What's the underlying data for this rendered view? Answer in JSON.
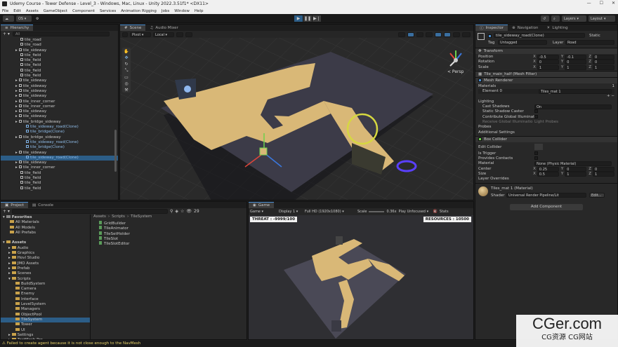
{
  "window": {
    "title": "Udemy Course - Tower Defense - Level_3 - Windows, Mac, Linux - Unity 2022.3.51f1* <DX11>",
    "min": "—",
    "max": "☐",
    "close": "✕"
  },
  "menu": [
    "File",
    "Edit",
    "Assets",
    "GameObject",
    "Component",
    "Services",
    "Animation Rigging",
    "Jobs",
    "Window",
    "Help"
  ],
  "toolbar": {
    "account": "OS ▾",
    "layers": "Layers",
    "layout": "Layout"
  },
  "hierarchy": {
    "tab": "Hierarchy",
    "search_placeholder": "All",
    "rows": [
      {
        "label": "tile_road",
        "indent": 0,
        "arrow": false,
        "prefab": false
      },
      {
        "label": "tile_road",
        "indent": 0,
        "arrow": false,
        "prefab": false
      },
      {
        "label": "tile_sideway",
        "indent": 0,
        "arrow": true,
        "prefab": false
      },
      {
        "label": "tile_field",
        "indent": 0,
        "arrow": false,
        "prefab": false
      },
      {
        "label": "tile_field",
        "indent": 0,
        "arrow": false,
        "prefab": false
      },
      {
        "label": "tile_field",
        "indent": 0,
        "arrow": false,
        "prefab": false
      },
      {
        "label": "tile_field",
        "indent": 0,
        "arrow": false,
        "prefab": false
      },
      {
        "label": "tile_field",
        "indent": 0,
        "arrow": false,
        "prefab": false
      },
      {
        "label": "tile_sideway",
        "indent": 0,
        "arrow": true,
        "prefab": false
      },
      {
        "label": "tile_sideway",
        "indent": 0,
        "arrow": true,
        "prefab": false
      },
      {
        "label": "tile_sideway",
        "indent": 0,
        "arrow": true,
        "prefab": false
      },
      {
        "label": "tile_sideway",
        "indent": 0,
        "arrow": true,
        "prefab": false
      },
      {
        "label": "tile_inner_corner",
        "indent": 0,
        "arrow": true,
        "prefab": false
      },
      {
        "label": "tile_inner_corner",
        "indent": 0,
        "arrow": true,
        "prefab": false
      },
      {
        "label": "tile_sideway",
        "indent": 0,
        "arrow": true,
        "prefab": false
      },
      {
        "label": "tile_sideway",
        "indent": 0,
        "arrow": true,
        "prefab": false
      },
      {
        "label": "tile_bridge_sideway",
        "indent": 0,
        "arrow": true,
        "prefab": false
      },
      {
        "label": "tile_sideway_road(Clone)",
        "indent": 1,
        "arrow": false,
        "prefab": true
      },
      {
        "label": "tile_bridge(Clone)",
        "indent": 1,
        "arrow": false,
        "prefab": true
      },
      {
        "label": "tile_bridge_sideway",
        "indent": 0,
        "arrow": true,
        "prefab": false
      },
      {
        "label": "tile_sideway_road(Clone)",
        "indent": 1,
        "arrow": false,
        "prefab": true
      },
      {
        "label": "tile_bridge(Clone)",
        "indent": 1,
        "arrow": false,
        "prefab": true
      },
      {
        "label": "tile_sideway",
        "indent": 0,
        "arrow": true,
        "prefab": false
      },
      {
        "label": "tile_sideway_road(Clone)",
        "indent": 1,
        "arrow": false,
        "prefab": true,
        "selected": true
      },
      {
        "label": "tile_sideway",
        "indent": 0,
        "arrow": true,
        "prefab": false
      },
      {
        "label": "tile_inner_corner",
        "indent": 0,
        "arrow": true,
        "prefab": false
      },
      {
        "label": "tile_field",
        "indent": 0,
        "arrow": false,
        "prefab": false
      },
      {
        "label": "tile_field",
        "indent": 0,
        "arrow": false,
        "prefab": false
      },
      {
        "label": "tile_field",
        "indent": 0,
        "arrow": false,
        "prefab": false
      },
      {
        "label": "tile_field",
        "indent": 0,
        "arrow": false,
        "prefab": false
      }
    ]
  },
  "scene": {
    "tabs": [
      "Scene",
      "Audio Mixer"
    ],
    "pivot": "Pivot",
    "local": "Local",
    "persp": "< Persp"
  },
  "project": {
    "tabs": [
      "Project",
      "Console"
    ],
    "count": "29",
    "breadcrumb": [
      "Assets",
      "Scripts",
      "TileSystem"
    ],
    "tree": [
      {
        "label": "Favorites",
        "indent": 0,
        "bold": true,
        "arrow": "▾"
      },
      {
        "label": "All Materials",
        "indent": 1,
        "bold": false,
        "arrow": ""
      },
      {
        "label": "All Models",
        "indent": 1,
        "bold": false,
        "arrow": ""
      },
      {
        "label": "All Prefabs",
        "indent": 1,
        "bold": false,
        "arrow": ""
      },
      {
        "label": "",
        "indent": 0,
        "bold": false,
        "arrow": ""
      },
      {
        "label": "Assets",
        "indent": 0,
        "bold": true,
        "arrow": "▾"
      },
      {
        "label": "Audio",
        "indent": 1,
        "bold": false,
        "arrow": "▸"
      },
      {
        "label": "Graphics",
        "indent": 1,
        "bold": false,
        "arrow": "▸"
      },
      {
        "label": "Hovl Studio",
        "indent": 1,
        "bold": false,
        "arrow": "▸"
      },
      {
        "label": "JMO Assets",
        "indent": 1,
        "bold": false,
        "arrow": "▸"
      },
      {
        "label": "Prefab",
        "indent": 1,
        "bold": false,
        "arrow": "▸"
      },
      {
        "label": "Scenes",
        "indent": 1,
        "bold": false,
        "arrow": "▸"
      },
      {
        "label": "Scripts",
        "indent": 1,
        "bold": false,
        "arrow": "▾"
      },
      {
        "label": "BuildSystem",
        "indent": 2,
        "bold": false,
        "arrow": ""
      },
      {
        "label": "Camera",
        "indent": 2,
        "bold": false,
        "arrow": ""
      },
      {
        "label": "Enemy",
        "indent": 2,
        "bold": false,
        "arrow": ""
      },
      {
        "label": "Interface",
        "indent": 2,
        "bold": false,
        "arrow": ""
      },
      {
        "label": "LevelSystem",
        "indent": 2,
        "bold": false,
        "arrow": ""
      },
      {
        "label": "Managers",
        "indent": 2,
        "bold": false,
        "arrow": ""
      },
      {
        "label": "ObjectPool",
        "indent": 2,
        "bold": false,
        "arrow": ""
      },
      {
        "label": "TileSystem",
        "indent": 2,
        "bold": false,
        "arrow": "",
        "selected": true
      },
      {
        "label": "Tower",
        "indent": 2,
        "bold": false,
        "arrow": ""
      },
      {
        "label": "UI",
        "indent": 2,
        "bold": false,
        "arrow": ""
      },
      {
        "label": "Settings",
        "indent": 1,
        "bold": false,
        "arrow": "▸"
      },
      {
        "label": "TextMesh Pro",
        "indent": 1,
        "bold": false,
        "arrow": "▸"
      }
    ],
    "files": [
      "GridBuilder",
      "TileAnimator",
      "TileSetHolder",
      "TileSlot",
      "TileSlotEditor"
    ]
  },
  "game": {
    "tab": "Game",
    "mode": "Game",
    "display": "Display 1",
    "resolution": "Full HD (1920x1080)",
    "scale_label": "Scale",
    "scale_value": "0.36x",
    "play_focus": "Play Unfocused",
    "stats": "Stats",
    "threat": "THREAT : -9999/100",
    "resources": "RESOURCES : 10500"
  },
  "inspector": {
    "tabs": [
      "Inspector",
      "Navigation",
      "Lighting"
    ],
    "object_name": "tile_sideway_road(Clone)",
    "static": "Static",
    "tag_label": "Tag",
    "tag": "Untagged",
    "layer_label": "Layer",
    "layer": "Road",
    "transform": {
      "title": "Transform",
      "rows": [
        {
          "label": "Position",
          "x": "-0.5",
          "y": "-0.1",
          "z": "0"
        },
        {
          "label": "Rotation",
          "x": "0",
          "y": "0",
          "z": "0"
        },
        {
          "label": "Scale",
          "x": "1",
          "y": "1",
          "z": "1"
        }
      ]
    },
    "mesh_filter": "Tile_main_half (Mesh Filter)",
    "mesh_renderer": "Mesh Renderer",
    "materials_label": "Materials",
    "materials_count": "1",
    "element0_label": "Element 0",
    "element0_value": "Tiles_mat 1",
    "lighting": "Lighting",
    "cast_shadows_label": "Cast Shadows",
    "cast_shadows": "On",
    "static_shadow_caster": "Static Shadow Caster",
    "contribute_gi": "Contribute Global Illuminat",
    "receive_gi_label": "Receive Global Illuminatio",
    "receive_gi": "Light Probes",
    "probes": "Probes",
    "additional_settings": "Additional Settings",
    "box_collider": "Box Collider",
    "edit_collider": "Edit Collider",
    "is_trigger": "Is Trigger",
    "provides_contacts": "Provides Contacts",
    "material_label": "Material",
    "material_value": "None (Physic Material)",
    "center": {
      "label": "Center",
      "x": "0.25",
      "y": "0",
      "z": "0"
    },
    "size": {
      "label": "Size",
      "x": "0.5",
      "y": "1",
      "z": "1"
    },
    "layer_overrides": "Layer Overrides",
    "mat_title": "Tiles_mat 1 (Material)",
    "shader_label": "Shader",
    "shader": "Universal Render Pipeline/Lit",
    "edit": "Edit...",
    "add_component": "Add Component"
  },
  "status": "Failed to create agent because it is not close enough to the NavMesh",
  "watermark": {
    "main": "CGer.com",
    "sub": "CG资源 CG网站"
  },
  "colors": {
    "accent": "#4a8fd4",
    "road": "#d9b877",
    "board": "#3c3b48",
    "selected": "#2c5d87"
  }
}
